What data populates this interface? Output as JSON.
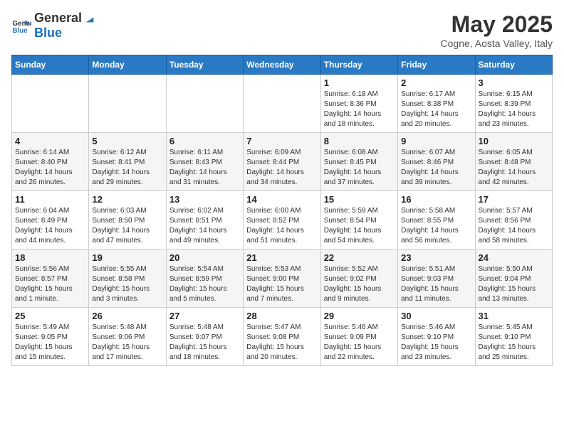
{
  "header": {
    "logo_general": "General",
    "logo_blue": "Blue",
    "title": "May 2025",
    "subtitle": "Cogne, Aosta Valley, Italy"
  },
  "weekdays": [
    "Sunday",
    "Monday",
    "Tuesday",
    "Wednesday",
    "Thursday",
    "Friday",
    "Saturday"
  ],
  "weeks": [
    [
      {
        "day": "",
        "info": ""
      },
      {
        "day": "",
        "info": ""
      },
      {
        "day": "",
        "info": ""
      },
      {
        "day": "",
        "info": ""
      },
      {
        "day": "1",
        "info": "Sunrise: 6:18 AM\nSunset: 8:36 PM\nDaylight: 14 hours\nand 18 minutes."
      },
      {
        "day": "2",
        "info": "Sunrise: 6:17 AM\nSunset: 8:38 PM\nDaylight: 14 hours\nand 20 minutes."
      },
      {
        "day": "3",
        "info": "Sunrise: 6:15 AM\nSunset: 8:39 PM\nDaylight: 14 hours\nand 23 minutes."
      }
    ],
    [
      {
        "day": "4",
        "info": "Sunrise: 6:14 AM\nSunset: 8:40 PM\nDaylight: 14 hours\nand 26 minutes."
      },
      {
        "day": "5",
        "info": "Sunrise: 6:12 AM\nSunset: 8:41 PM\nDaylight: 14 hours\nand 29 minutes."
      },
      {
        "day": "6",
        "info": "Sunrise: 6:11 AM\nSunset: 8:43 PM\nDaylight: 14 hours\nand 31 minutes."
      },
      {
        "day": "7",
        "info": "Sunrise: 6:09 AM\nSunset: 8:44 PM\nDaylight: 14 hours\nand 34 minutes."
      },
      {
        "day": "8",
        "info": "Sunrise: 6:08 AM\nSunset: 8:45 PM\nDaylight: 14 hours\nand 37 minutes."
      },
      {
        "day": "9",
        "info": "Sunrise: 6:07 AM\nSunset: 8:46 PM\nDaylight: 14 hours\nand 39 minutes."
      },
      {
        "day": "10",
        "info": "Sunrise: 6:05 AM\nSunset: 8:48 PM\nDaylight: 14 hours\nand 42 minutes."
      }
    ],
    [
      {
        "day": "11",
        "info": "Sunrise: 6:04 AM\nSunset: 8:49 PM\nDaylight: 14 hours\nand 44 minutes."
      },
      {
        "day": "12",
        "info": "Sunrise: 6:03 AM\nSunset: 8:50 PM\nDaylight: 14 hours\nand 47 minutes."
      },
      {
        "day": "13",
        "info": "Sunrise: 6:02 AM\nSunset: 8:51 PM\nDaylight: 14 hours\nand 49 minutes."
      },
      {
        "day": "14",
        "info": "Sunrise: 6:00 AM\nSunset: 8:52 PM\nDaylight: 14 hours\nand 51 minutes."
      },
      {
        "day": "15",
        "info": "Sunrise: 5:59 AM\nSunset: 8:54 PM\nDaylight: 14 hours\nand 54 minutes."
      },
      {
        "day": "16",
        "info": "Sunrise: 5:58 AM\nSunset: 8:55 PM\nDaylight: 14 hours\nand 56 minutes."
      },
      {
        "day": "17",
        "info": "Sunrise: 5:57 AM\nSunset: 8:56 PM\nDaylight: 14 hours\nand 58 minutes."
      }
    ],
    [
      {
        "day": "18",
        "info": "Sunrise: 5:56 AM\nSunset: 8:57 PM\nDaylight: 15 hours\nand 1 minute."
      },
      {
        "day": "19",
        "info": "Sunrise: 5:55 AM\nSunset: 8:58 PM\nDaylight: 15 hours\nand 3 minutes."
      },
      {
        "day": "20",
        "info": "Sunrise: 5:54 AM\nSunset: 8:59 PM\nDaylight: 15 hours\nand 5 minutes."
      },
      {
        "day": "21",
        "info": "Sunrise: 5:53 AM\nSunset: 9:00 PM\nDaylight: 15 hours\nand 7 minutes."
      },
      {
        "day": "22",
        "info": "Sunrise: 5:52 AM\nSunset: 9:02 PM\nDaylight: 15 hours\nand 9 minutes."
      },
      {
        "day": "23",
        "info": "Sunrise: 5:51 AM\nSunset: 9:03 PM\nDaylight: 15 hours\nand 11 minutes."
      },
      {
        "day": "24",
        "info": "Sunrise: 5:50 AM\nSunset: 9:04 PM\nDaylight: 15 hours\nand 13 minutes."
      }
    ],
    [
      {
        "day": "25",
        "info": "Sunrise: 5:49 AM\nSunset: 9:05 PM\nDaylight: 15 hours\nand 15 minutes."
      },
      {
        "day": "26",
        "info": "Sunrise: 5:48 AM\nSunset: 9:06 PM\nDaylight: 15 hours\nand 17 minutes."
      },
      {
        "day": "27",
        "info": "Sunrise: 5:48 AM\nSunset: 9:07 PM\nDaylight: 15 hours\nand 18 minutes."
      },
      {
        "day": "28",
        "info": "Sunrise: 5:47 AM\nSunset: 9:08 PM\nDaylight: 15 hours\nand 20 minutes."
      },
      {
        "day": "29",
        "info": "Sunrise: 5:46 AM\nSunset: 9:09 PM\nDaylight: 15 hours\nand 22 minutes."
      },
      {
        "day": "30",
        "info": "Sunrise: 5:46 AM\nSunset: 9:10 PM\nDaylight: 15 hours\nand 23 minutes."
      },
      {
        "day": "31",
        "info": "Sunrise: 5:45 AM\nSunset: 9:10 PM\nDaylight: 15 hours\nand 25 minutes."
      }
    ]
  ]
}
